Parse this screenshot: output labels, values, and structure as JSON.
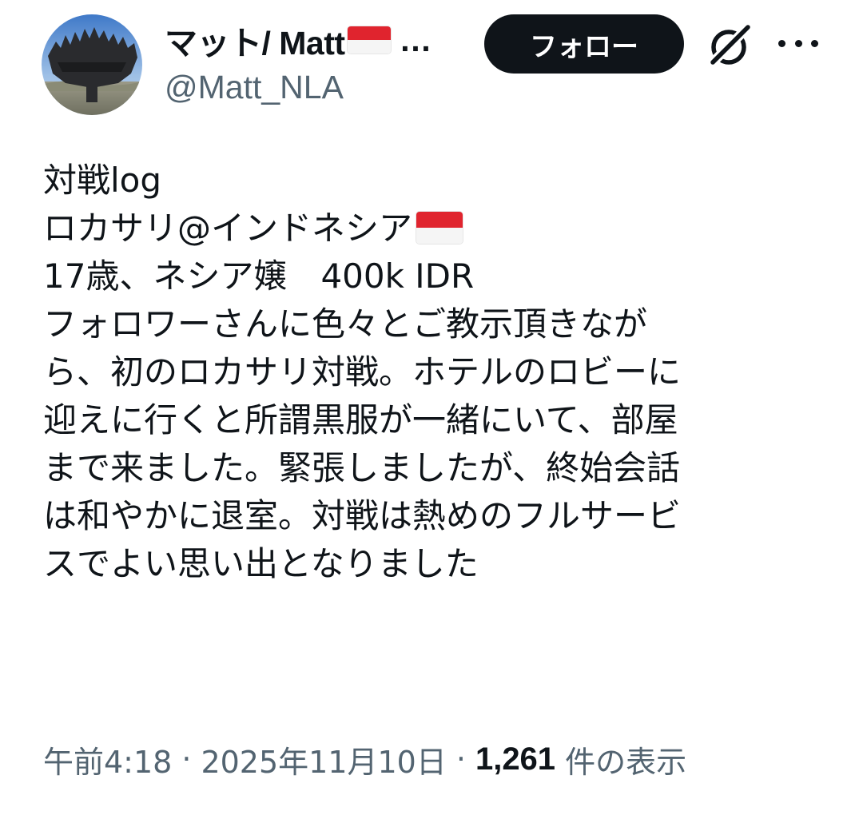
{
  "author": {
    "display_name": "マット/ Matt",
    "name_truncation": "…",
    "handle": "@Matt_NLA",
    "avatar_icon": "avatar-photo-sculpture",
    "flag_icon": "indonesia-flag-icon"
  },
  "actions": {
    "follow_label": "フォロー",
    "grok_icon": "grok-icon",
    "more_icon": "more-horizontal-icon"
  },
  "tweet": {
    "lines": [
      "対戦log",
      "ロカサリ@インドネシア",
      "17歳、ネシア嬢　400k IDR",
      "フォロワーさんに色々とご教示頂きなが",
      "ら、初のロカサリ対戦。ホテルのロビーに",
      "迎えに行くと所謂黒服が一緒にいて、部屋",
      "まで来ました。緊張しましたが、終始会話",
      "は和やかに退室。対戦は熱めのフルサービ",
      "スでよい思い出となりました"
    ]
  },
  "meta": {
    "time": "午前4:18",
    "separator": "·",
    "date": "2025年11月10日",
    "views_count": "1,261",
    "views_label": "件の表示"
  },
  "colors": {
    "text_primary": "#0f1419",
    "text_secondary": "#536471",
    "button_bg": "#0f1419",
    "button_text": "#ffffff",
    "flag_red": "#e0242e",
    "flag_white": "#f5f5f5"
  }
}
